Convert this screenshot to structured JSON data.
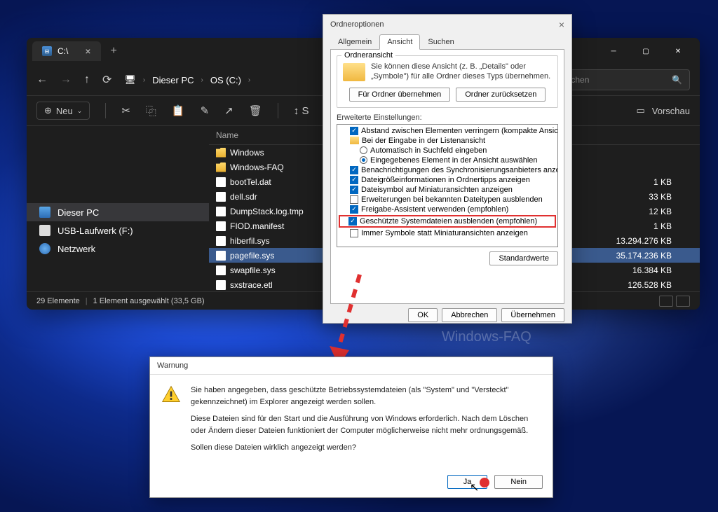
{
  "explorer": {
    "tab_title": "C:\\",
    "breadcrumb": {
      "item1": "Dieser PC",
      "item2": "OS (C:)"
    },
    "search_placeholder": "hsuchen",
    "new_button": "Neu",
    "preview_label": "Vorschau",
    "col_name": "Name",
    "sidebar": {
      "item1": "Dieser PC",
      "item2": "USB-Laufwerk (F:)",
      "item3": "Netzwerk"
    },
    "files": [
      {
        "name": "Windows",
        "type": "folder",
        "size": ""
      },
      {
        "name": "Windows-FAQ",
        "type": "folder",
        "size": ""
      },
      {
        "name": "bootTel.dat",
        "type": "file",
        "size": "1 KB"
      },
      {
        "name": "dell.sdr",
        "type": "file",
        "size": "33 KB"
      },
      {
        "name": "DumpStack.log.tmp",
        "type": "file",
        "size": "12 KB"
      },
      {
        "name": "FIOD.manifest",
        "type": "file",
        "size": "1 KB"
      },
      {
        "name": "hiberfil.sys",
        "type": "file",
        "size": "13.294.276 KB"
      },
      {
        "name": "pagefile.sys",
        "type": "file",
        "size": "35.174.236 KB"
      },
      {
        "name": "swapfile.sys",
        "type": "file",
        "size": "16.384 KB"
      },
      {
        "name": "sxstrace.etl",
        "type": "file",
        "size": "126.528 KB"
      }
    ],
    "status": {
      "count": "29 Elemente",
      "selected": "1 Element ausgewählt (33,5 GB)"
    }
  },
  "folderopts": {
    "title": "Ordneroptionen",
    "tab1": "Allgemein",
    "tab2": "Ansicht",
    "tab3": "Suchen",
    "group1_title": "Ordneransicht",
    "group1_text": "Sie können diese Ansicht (z. B. „Details\" oder „Symbole\") für alle Ordner dieses Typs übernehmen.",
    "btn_apply_folders": "Für Ordner übernehmen",
    "btn_reset_folders": "Ordner zurücksetzen",
    "adv_label": "Erweiterte Einstellungen:",
    "tree": {
      "i1": "Abstand zwischen Elementen verringern (kompakte Ansicht",
      "i2": "Bei der Eingabe in der Listenansicht",
      "i3": "Automatisch in Suchfeld eingeben",
      "i4": "Eingegebenes Element in der Ansicht auswählen",
      "i5": "Benachrichtigungen des Synchronisierungsanbieters anzeig",
      "i6": "Dateigrößeinformationen in Ordnertipps anzeigen",
      "i7": "Dateisymbol auf Miniaturansichten anzeigen",
      "i8": "Erweiterungen bei bekannten Dateitypen ausblenden",
      "i9": "Freigabe-Assistent verwenden (empfohlen)",
      "i10": "Geschützte Systemdateien ausblenden (empfohlen)",
      "i11": "Immer Symbole statt Miniaturansichten anzeigen"
    },
    "btn_defaults": "Standardwerte",
    "btn_ok": "OK",
    "btn_cancel": "Abbrechen",
    "btn_apply": "Übernehmen"
  },
  "warning": {
    "title": "Warnung",
    "p1": "Sie haben angegeben, dass geschützte Betriebssystemdateien (als \"System\" und \"Versteckt\" gekennzeichnet) im Explorer angezeigt werden sollen.",
    "p2": "Diese Dateien sind für den Start und die Ausführung von Windows erforderlich. Nach dem Löschen oder Ändern dieser Dateien funktioniert der Computer möglicherweise nicht mehr ordnungsgemäß.",
    "p3": "Sollen diese Dateien wirklich angezeigt werden?",
    "btn_yes": "Ja",
    "btn_no": "Nein"
  },
  "watermark": "Windows-FAQ"
}
